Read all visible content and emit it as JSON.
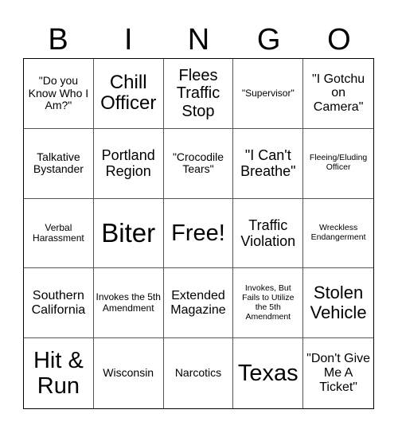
{
  "header": {
    "letters": [
      "B",
      "I",
      "N",
      "G",
      "O"
    ]
  },
  "board": {
    "rows": [
      [
        "\"Do you Know Who I Am?\"",
        "Chill Officer",
        "Flees Traffic Stop",
        "\"Supervisor\"",
        "\"I Gotchu on Camera\""
      ],
      [
        "Talkative Bystander",
        "Portland Region",
        "\"Crocodile Tears\"",
        "\"I Can't Breathe\"",
        "Fleeing/Eluding Officer"
      ],
      [
        "Verbal Harassment",
        "Biter",
        "Free!",
        "Traffic Violation",
        "Wreckless Endangerment"
      ],
      [
        "Southern California",
        "Invokes the 5th Amendment",
        "Extended Magazine",
        "Invokes, But Fails to Utilize the 5th Amendment",
        "Stolen Vehicle"
      ],
      [
        "Hit & Run",
        "Wisconsin",
        "Narcotics",
        "Texas",
        "\"Don't Give Me A Ticket\""
      ]
    ],
    "free_space": {
      "row": 2,
      "col": 2
    }
  }
}
